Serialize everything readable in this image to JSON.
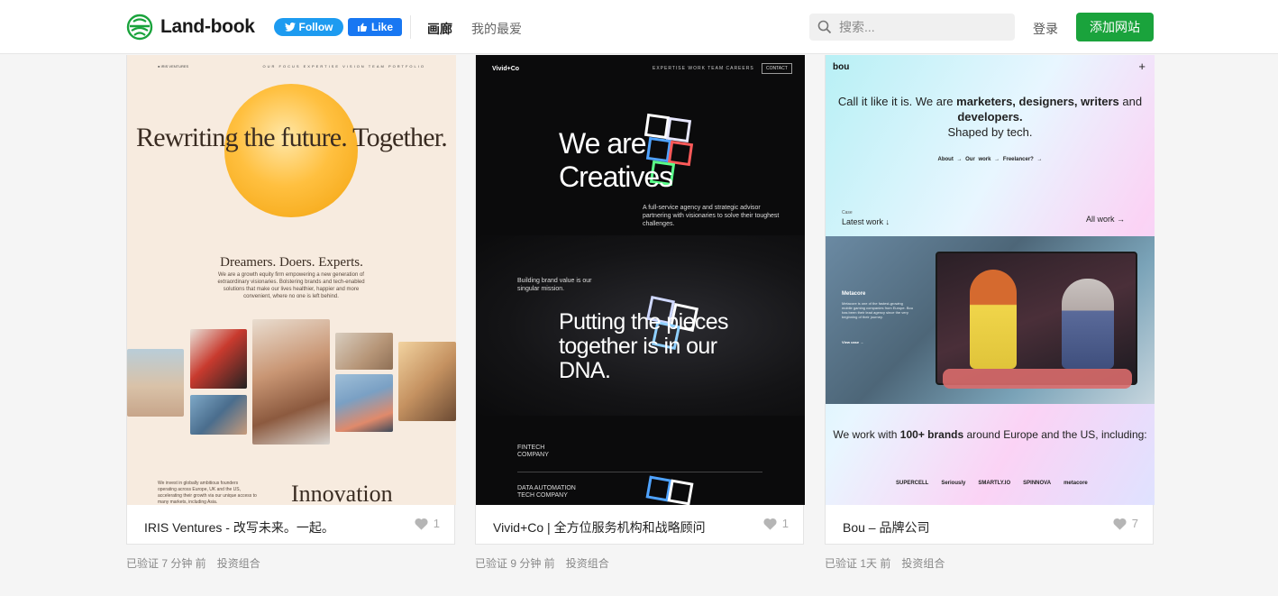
{
  "header": {
    "logo_text": "Land-book",
    "twitter_label": "Follow",
    "facebook_label": "Like",
    "nav": {
      "gallery": "画廊",
      "favorites": "我的最爱"
    },
    "search_placeholder": "搜索...",
    "login": "登录",
    "add_site": "添加网站",
    "colors": {
      "brand_green": "#1aa33c",
      "twitter": "#1d9bf0",
      "facebook": "#1877f2"
    }
  },
  "cards": [
    {
      "title": "IRIS Ventures - 改写未来。一起。",
      "likes": "1",
      "verified": "已验证 7 分钟 前",
      "category": "投资组合",
      "preview": {
        "brand": "● IRIS VENTURES",
        "nav": "OUR FOCUS  EXPERTISE  VISION  TEAM  PORTFOLIO",
        "headline": "Rewriting the future. Together.",
        "sub": "Dreamers. Doers. Experts.",
        "para": "We are a growth equity firm empowering a new generation of extraordinary visionaries. Bolstering brands and tech-enabled solutions that make our lives healthier, happier and more convenient, where no one is left behind.",
        "para2": "We invest in globally ambitious founders operating across Europe, UK and the US, accelerating their growth via our unique access to many markets, including Asia.",
        "innovation": "Innovation"
      }
    },
    {
      "title": "Vivid+Co | 全方位服务机构和战略顾问",
      "likes": "1",
      "verified": "已验证 9 分钟 前",
      "category": "投资组合",
      "preview": {
        "brand": "Vivid+Co",
        "nav": "EXPERTISE   WORK   TEAM   CAREERS",
        "contact": "CONTACT",
        "headline": "We are Creatives",
        "para": "A full-service agency and strategic advisor partnering with visionaries to solve their toughest challenges.",
        "mission": "Building brand value is our singular mission.",
        "headline2": "Putting the pieces together is in our DNA.",
        "fintech": "FINTECH COMPANY",
        "data": "DATA AUTOMATION TECH COMPANY"
      }
    },
    {
      "title": "Bou – 品牌公司",
      "likes": "7",
      "verified": "已验证 1天 前",
      "category": "投资组合",
      "preview": {
        "brand": "bou",
        "plus": "+",
        "headline_a": "Call it like it is. We are ",
        "headline_b": "marketers, designers, writers",
        "headline_c": " and ",
        "headline_d": "developers.",
        "headline_e": "Shaped by tech.",
        "links": "About →   Our work →   Freelancer? →",
        "case": "Case",
        "latest": "Latest work ↓",
        "allwork": "All work →",
        "metacore": "Metacore",
        "metacore_para": "Metacore is one of the fastest-growing mobile gaming companies from Europe. Bou has been their lead agency since the very beginning of their journey.",
        "view_case": "View case →",
        "headline2_a": "We work with ",
        "headline2_b": "100+ brands",
        "headline2_c": " around Europe and the US, including:",
        "logos": [
          "SUPERCELL",
          "Seriously",
          "SMARTLY.IO",
          "SPINNOVA",
          "metacore"
        ]
      }
    }
  ]
}
